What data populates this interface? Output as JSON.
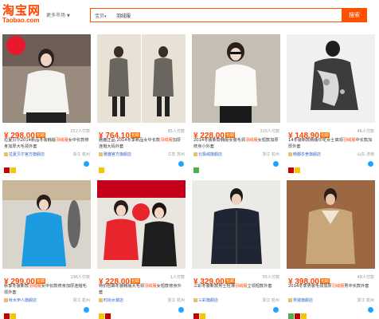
{
  "header": {
    "logo_zh": "淘宝网",
    "logo_en": "Taobao.com",
    "region": "更多市场",
    "search_category": "宝贝",
    "search_value": "羽绒服",
    "search_button": "搜索"
  },
  "products": [
    {
      "price": "¥ 298.00",
      "badge": "包邮",
      "sales": "252人付款",
      "title_pre": "拉夏贝尔2014新品冬装韩版",
      "title_hl": "羽绒服",
      "title_post": "女中长款修身加厚大毛领外套",
      "shop": "拉夏贝尔官方旗舰店",
      "location": "浙江 杭州"
    },
    {
      "price": "¥ 764.10",
      "badge": "包邮",
      "sales": "85人付款",
      "title_pre": "雅鹿正品 2014冬季新品女中长款",
      "title_hl": "羽绒服",
      "title_post": "加厚连帽大码外套",
      "shop": "雅鹿官方旗舰店",
      "location": "江苏 苏州"
    },
    {
      "price": "¥ 228.00",
      "badge": "包邮",
      "sales": "315人付款",
      "title_pre": "2014冬装新款韩版女装毛领",
      "title_hl": "羽绒服",
      "title_post": "女短款加厚修身小外套",
      "shop": "北极绒旗舰店",
      "location": "浙江 杭州"
    },
    {
      "price": "¥ 148.90",
      "badge": "包邮",
      "sales": "46人付款",
      "title_pre": "14冬装新款韩版印花女士高领",
      "title_hl": "羽绒服",
      "title_post": "中长款加厚外套",
      "shop": "韩都衣舍旗舰店",
      "location": "山东 济南"
    },
    {
      "price": "¥ 299.00",
      "badge": "包邮",
      "sales": "196人付款",
      "title_pre": "秋季冬装新款",
      "title_hl": "羽绒服",
      "title_post": "女中长款修身加厚连帽毛领外套",
      "shop": "秋水伊人旗舰店",
      "location": "浙江 杭州"
    },
    {
      "price": "¥ 228.00",
      "badge": "包邮",
      "sales": "1人付款",
      "title_pre": "特价包邮冬装韩版大毛领",
      "title_hl": "羽绒服",
      "title_post": "女短款修身外套",
      "shop": "时尚女装店",
      "location": "浙江 杭州"
    },
    {
      "price": "¥ 329.00",
      "badge": "包邮",
      "sales": "55人付款",
      "title_pre": "三彩冬装新款男士轻薄",
      "title_hl": "羽绒服",
      "title_post": "立领短款外套",
      "shop": "三彩旗舰店",
      "location": "浙江 杭州"
    },
    {
      "price": "¥ 398.00",
      "badge": "包邮",
      "sales": "48人付款",
      "title_pre": "2014冬季男装毛领加厚",
      "title_hl": "羽绒服",
      "title_post": "男中长款外套",
      "shop": "男装旗舰店",
      "location": "浙江 杭州"
    }
  ]
}
